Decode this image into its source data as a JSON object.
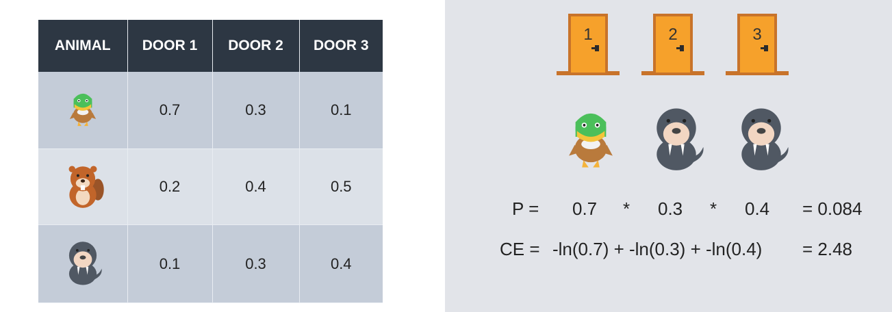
{
  "table": {
    "headers": [
      "ANIMAL",
      "DOOR 1",
      "DOOR 2",
      "DOOR 3"
    ],
    "rows": [
      {
        "animal": "duck-icon",
        "values": [
          "0.7",
          "0.3",
          "0.1"
        ]
      },
      {
        "animal": "beaver-icon",
        "values": [
          "0.2",
          "0.4",
          "0.5"
        ]
      },
      {
        "animal": "walrus-icon",
        "values": [
          "0.1",
          "0.3",
          "0.4"
        ]
      }
    ]
  },
  "doors": [
    {
      "number": "1",
      "animal": "duck-icon"
    },
    {
      "number": "2",
      "animal": "walrus-icon"
    },
    {
      "number": "3",
      "animal": "walrus-icon"
    }
  ],
  "equations": {
    "p_label": "P =",
    "p_terms": [
      "0.7",
      "*",
      "0.3",
      "*",
      "0.4"
    ],
    "p_result": "= 0.084",
    "ce_label": "CE =",
    "ce_expr": "-ln(0.7) + -ln(0.3) + -ln(0.4)",
    "ce_result": "= 2.48"
  },
  "colors": {
    "header_bg": "#2d3743",
    "row_dark": "#c4ccd8",
    "row_light": "#dce1e8",
    "right_bg": "#e2e4e9",
    "door_orange": "#f6a12b",
    "door_frame": "#c8732a"
  }
}
